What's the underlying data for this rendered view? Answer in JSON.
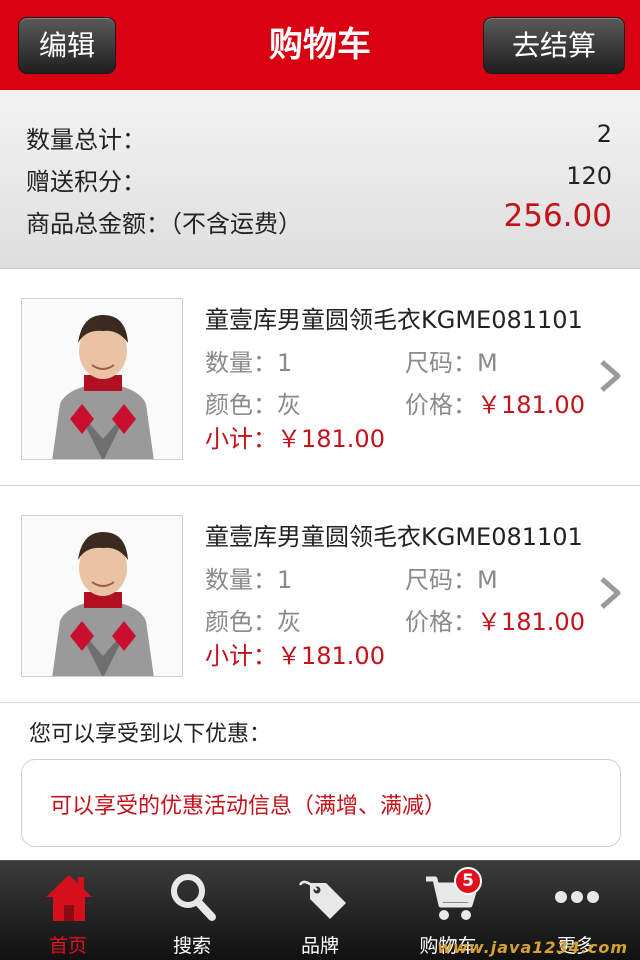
{
  "header": {
    "title": "购物车",
    "edit_label": "编辑",
    "checkout_label": "去结算"
  },
  "summary": {
    "quantity_label": "数量总计：",
    "quantity_value": "2",
    "points_label": "赠送积分：",
    "points_value": "120",
    "total_label": "商品总金额：（不含运费）",
    "total_value": "256.00"
  },
  "items": [
    {
      "name": "童壹库男童圆领毛衣KGME081101",
      "qty_label": "数量：",
      "qty": "1",
      "size_label": "尺码：",
      "size": "M",
      "color_label": "颜色：",
      "color": "灰",
      "price_label": "价格：",
      "price": "￥181.00",
      "subtotal_label": "小计：",
      "subtotal": "￥181.00"
    },
    {
      "name": "童壹库男童圆领毛衣KGME081101",
      "qty_label": "数量：",
      "qty": "1",
      "size_label": "尺码：",
      "size": "M",
      "color_label": "颜色：",
      "color": "灰",
      "price_label": "价格：",
      "price": "￥181.00",
      "subtotal_label": "小计：",
      "subtotal": "￥181.00"
    }
  ],
  "promotion": {
    "title": "您可以享受到以下优惠：",
    "text": "可以享受的优惠活动信息（满增、满减）"
  },
  "tabbar": {
    "tabs": [
      {
        "label": "首页",
        "icon": "home-icon",
        "active": true
      },
      {
        "label": "搜索",
        "icon": "search-icon",
        "active": false
      },
      {
        "label": "品牌",
        "icon": "tag-icon",
        "active": false
      },
      {
        "label": "购物车",
        "icon": "cart-icon",
        "active": false,
        "badge": "5"
      },
      {
        "label": "更多",
        "icon": "more-icon",
        "active": false
      }
    ]
  },
  "watermark": "www.java1234.com",
  "colors": {
    "brand_red": "#d90012",
    "price_red": "#c4121b",
    "tabbar_dark": "#1a1a1a"
  }
}
